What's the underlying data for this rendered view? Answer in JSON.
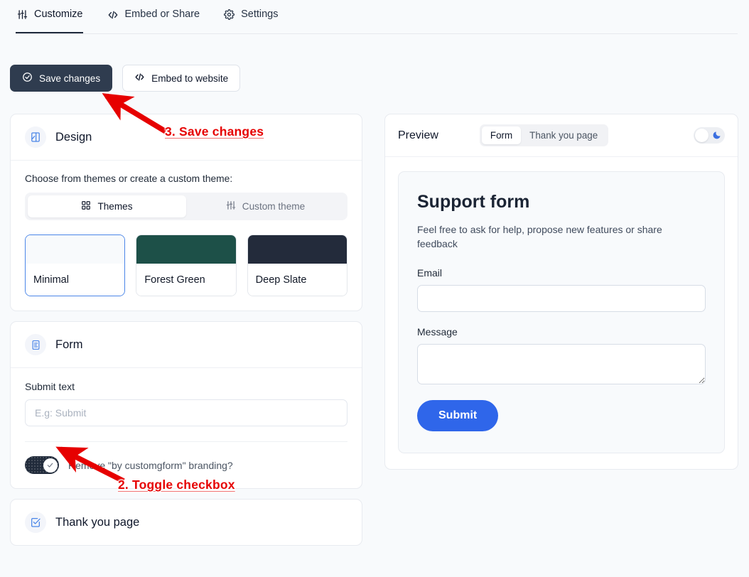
{
  "tabs": [
    {
      "label": "Customize",
      "icon": "sliders-icon",
      "active": true
    },
    {
      "label": "Embed or Share",
      "icon": "code-icon",
      "active": false
    },
    {
      "label": "Settings",
      "icon": "gear-icon",
      "active": false
    }
  ],
  "actions": {
    "save_label": "Save changes",
    "embed_label": "Embed to website"
  },
  "design": {
    "title": "Design",
    "icon": "palette-icon",
    "hint": "Choose from themes or create a custom theme:",
    "segments": [
      {
        "label": "Themes",
        "icon": "grid-icon",
        "active": true
      },
      {
        "label": "Custom theme",
        "icon": "sliders-icon",
        "active": false
      }
    ],
    "themes": [
      {
        "name": "Minimal",
        "swatch": "#f8fafc",
        "selected": true
      },
      {
        "name": "Forest Green",
        "swatch": "#1d5048",
        "selected": false
      },
      {
        "name": "Deep Slate",
        "swatch": "#232b3b",
        "selected": false
      }
    ]
  },
  "form_card": {
    "title": "Form",
    "icon": "document-icon",
    "submit_text_label": "Submit text",
    "submit_text_value": "",
    "submit_text_placeholder": "E.g: Submit",
    "branding_toggle_label": "Remove \"by customgform\" branding?",
    "branding_toggle_on": true
  },
  "thankyou_card": {
    "title": "Thank you page",
    "icon": "checkbox-checked-icon"
  },
  "preview": {
    "title": "Preview",
    "segments": [
      {
        "label": "Form",
        "active": true
      },
      {
        "label": "Thank you page",
        "active": false
      }
    ],
    "dark_mode_icon": "moon-icon",
    "dark_mode_on": false,
    "mock": {
      "title": "Support form",
      "description": "Feel free to ask for help, propose new features or share feedback",
      "email_label": "Email",
      "email_value": "",
      "message_label": "Message",
      "message_value": "",
      "submit_label": "Submit",
      "submit_color": "#2f66ea"
    }
  },
  "annotations": [
    {
      "text": "3. Save changes",
      "color": "#e60000"
    },
    {
      "text": "2. Toggle checkbox",
      "color": "#e60000"
    }
  ]
}
